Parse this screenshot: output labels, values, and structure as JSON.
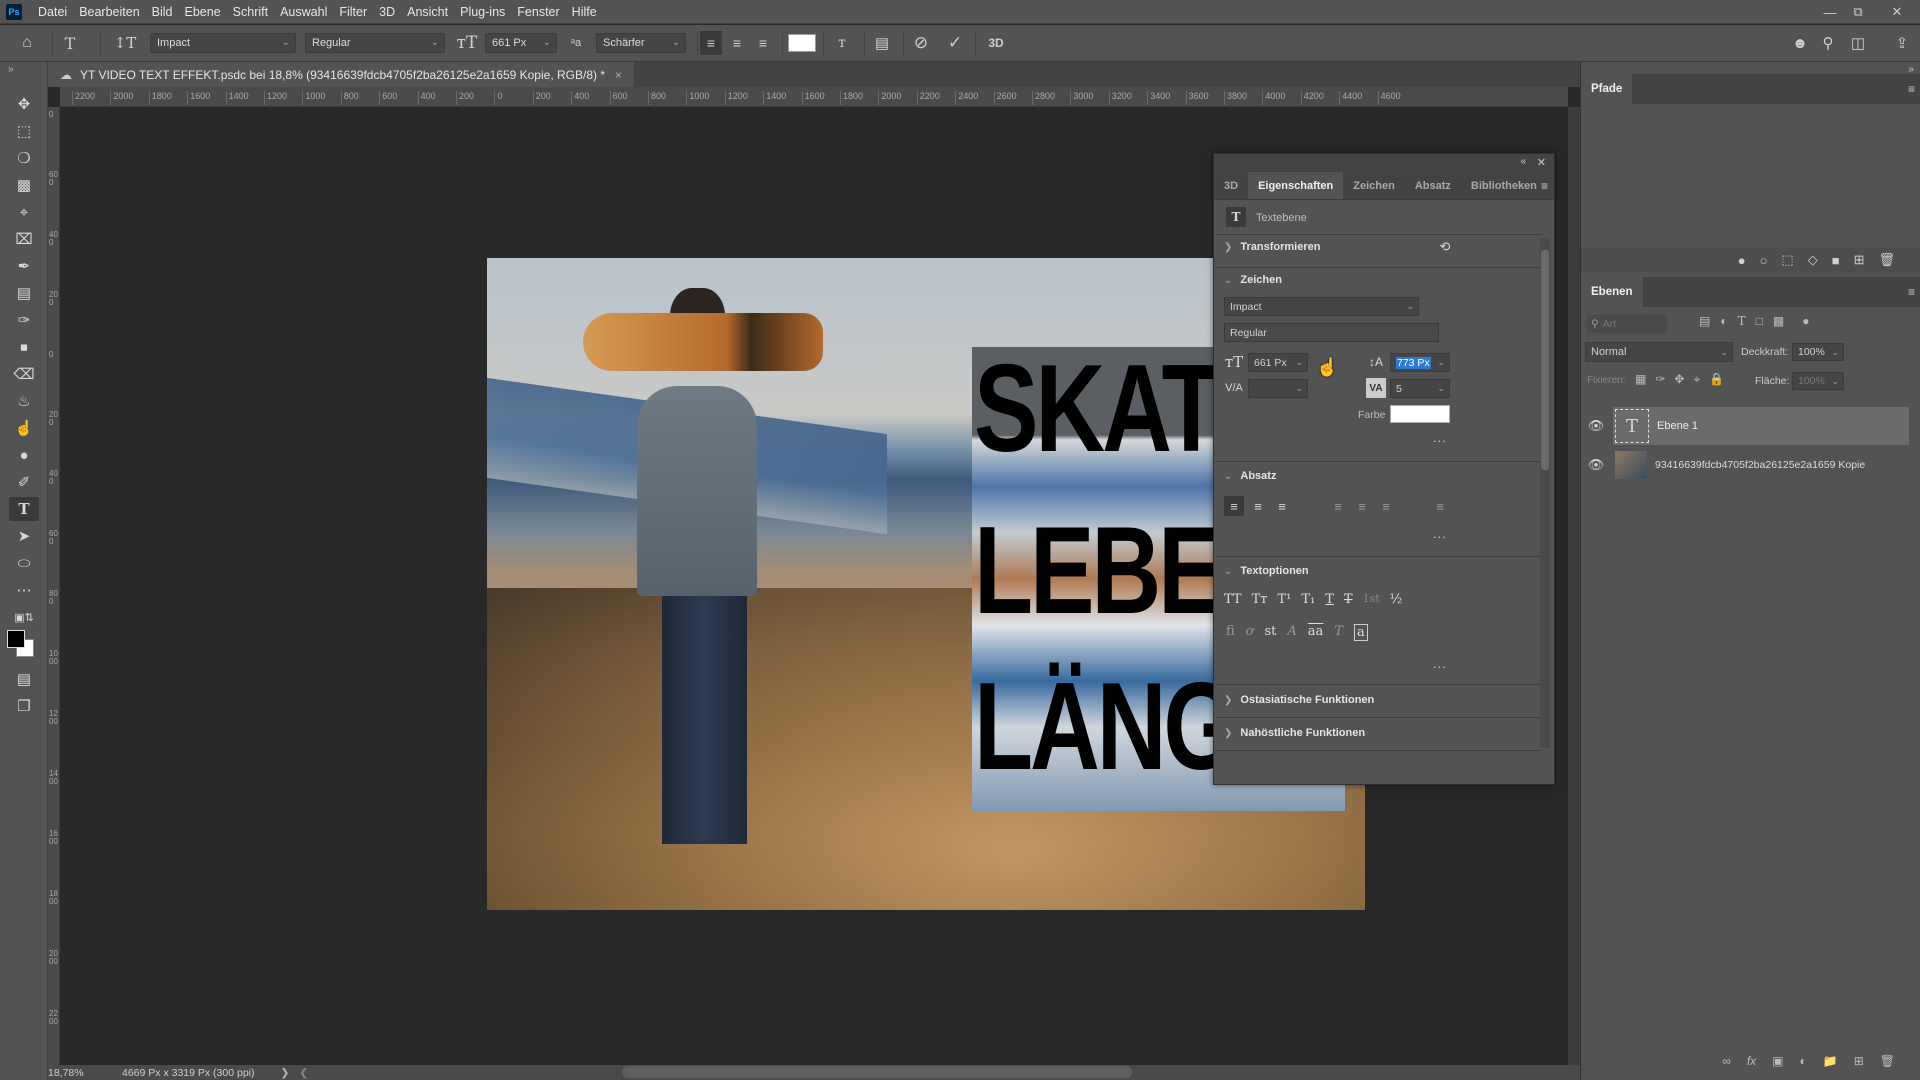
{
  "app": {
    "logo": "Ps",
    "window_controls": [
      "minimize",
      "restore",
      "close"
    ]
  },
  "menu": [
    "Datei",
    "Bearbeiten",
    "Bild",
    "Ebene",
    "Schrift",
    "Auswahl",
    "Filter",
    "3D",
    "Ansicht",
    "Plug-ins",
    "Fenster",
    "Hilfe"
  ],
  "options_bar": {
    "font_family": "Impact",
    "font_style": "Regular",
    "font_size": "661 Px",
    "antialias": "Schärfer",
    "alignment_selected": "left",
    "text_color": "#ffffff",
    "label_3d": "3D"
  },
  "document": {
    "tab_title": "YT VIDEO TEXT EFFEKT.psdc bei 18,8% (93416639fdcb4705f2ba26125e2a1659 Kopie, RGB/8) *",
    "close": "×"
  },
  "ruler": {
    "horizontal": [
      "2200",
      "2000",
      "1800",
      "1600",
      "1400",
      "1200",
      "1000",
      "800",
      "600",
      "400",
      "200",
      "0",
      "200",
      "400",
      "600",
      "800",
      "1000",
      "1200",
      "1400",
      "1600",
      "1800",
      "2000",
      "2200",
      "2400",
      "2600",
      "2800",
      "3000",
      "3200",
      "3400",
      "3600",
      "3800",
      "4000",
      "4200",
      "4400",
      "4600"
    ],
    "vertical": [
      "0",
      "600",
      "400",
      "200",
      "0",
      "200",
      "400",
      "600",
      "800",
      "1000",
      "1200",
      "1400",
      "1600",
      "1800",
      "2000",
      "2200"
    ]
  },
  "canvas": {
    "text_lines": [
      "SKAT",
      "LEBE",
      "LÄNG"
    ]
  },
  "tools": [
    "move",
    "marquee",
    "lasso",
    "object-select",
    "crop",
    "frame",
    "eyedropper",
    "healing",
    "brush",
    "stamp",
    "eraser",
    "paint-bucket",
    "smudge",
    "dodge",
    "pen",
    "type",
    "path-select",
    "ellipse",
    "more",
    "swap-colors",
    "fg-bg-colors",
    "quick-mask",
    "screen-mode"
  ],
  "properties": {
    "tabs": [
      "3D",
      "Eigenschaften",
      "Zeichen",
      "Absatz",
      "Bibliotheken"
    ],
    "active_tab": "Eigenschaften",
    "layer_type": "Textebene",
    "sections": {
      "transform": "Transformieren",
      "character": "Zeichen",
      "paragraph": "Absatz",
      "text_options": "Textoptionen",
      "east_asian": "Ostasiatische Funktionen",
      "middle_eastern": "Nahöstliche Funktionen"
    },
    "character": {
      "font_family": "Impact",
      "font_style": "Regular",
      "font_size": "661 Px",
      "leading": "773 Px",
      "kerning": "",
      "tracking": "5",
      "color_label": "Farbe",
      "color": "#ffffff"
    },
    "text_options_row1": [
      "TT",
      "Tт",
      "T¹",
      "T₁",
      "T",
      "T̶",
      "1st",
      "½"
    ],
    "text_options_row2": [
      "ﬁ",
      "ơ",
      "st",
      "A",
      "aa",
      "T",
      "a"
    ],
    "more": "..."
  },
  "paths_panel": {
    "title": "Pfade"
  },
  "layers_panel": {
    "title": "Ebenen",
    "search_placeholder": "Art",
    "blend_mode": "Normal",
    "opacity_label": "Deckkraft:",
    "opacity": "100%",
    "lock_label": "Fixieren:",
    "fill_label": "Fläche:",
    "fill": "100%",
    "layers": [
      {
        "name": "Ebene 1",
        "type": "text",
        "visible": true,
        "selected": true
      },
      {
        "name": "93416639fdcb4705f2ba26125e2a1659 Kopie",
        "type": "smart-object",
        "visible": true,
        "selected": false
      }
    ]
  },
  "status": {
    "zoom": "18,78%",
    "doc_size": "4669 Px x 3319 Px (300 ppi)"
  }
}
